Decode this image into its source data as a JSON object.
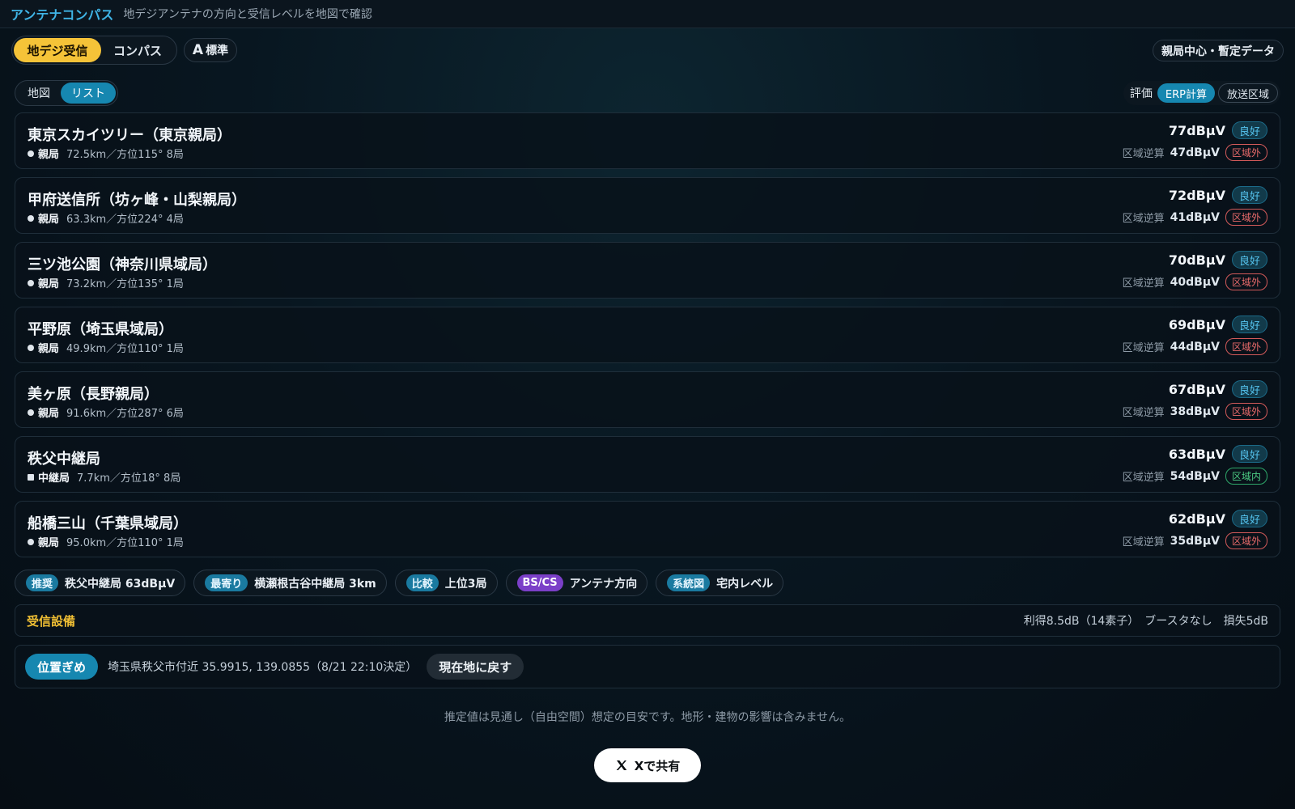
{
  "header": {
    "title": "アンテナコンパス",
    "subtitle": "地デジアンテナの方向と受信レベルを地図で確認"
  },
  "mode": {
    "tabs": [
      "地デジ受信",
      "コンパス"
    ],
    "size_glyph": "A",
    "size_label": "標準",
    "data_badge": "親局中心・暫定データ"
  },
  "view": {
    "options": [
      "地図",
      "リスト"
    ],
    "eval_label": "評価",
    "eval_options": [
      "ERP計算",
      "放送区域"
    ]
  },
  "stations": [
    {
      "name": "東京スカイツリー（東京親局）",
      "type": "親局",
      "meta": "72.5km／方位115°  8局",
      "level": "77dBμV",
      "grade": "良好",
      "rev_label": "区域逆算",
      "rev": "47dBμV",
      "zone": "区域外",
      "zone_in": false,
      "square": false
    },
    {
      "name": "甲府送信所（坊ヶ峰・山梨親局）",
      "type": "親局",
      "meta": "63.3km／方位224°  4局",
      "level": "72dBμV",
      "grade": "良好",
      "rev_label": "区域逆算",
      "rev": "41dBμV",
      "zone": "区域外",
      "zone_in": false,
      "square": false
    },
    {
      "name": "三ツ池公園（神奈川県域局）",
      "type": "親局",
      "meta": "73.2km／方位135°  1局",
      "level": "70dBμV",
      "grade": "良好",
      "rev_label": "区域逆算",
      "rev": "40dBμV",
      "zone": "区域外",
      "zone_in": false,
      "square": false
    },
    {
      "name": "平野原（埼玉県域局）",
      "type": "親局",
      "meta": "49.9km／方位110°  1局",
      "level": "69dBμV",
      "grade": "良好",
      "rev_label": "区域逆算",
      "rev": "44dBμV",
      "zone": "区域外",
      "zone_in": false,
      "square": false
    },
    {
      "name": "美ヶ原（長野親局）",
      "type": "親局",
      "meta": "91.6km／方位287°  6局",
      "level": "67dBμV",
      "grade": "良好",
      "rev_label": "区域逆算",
      "rev": "38dBμV",
      "zone": "区域外",
      "zone_in": false,
      "square": false
    },
    {
      "name": "秩父中継局",
      "type": "中継局",
      "meta": "7.7km／方位18°  8局",
      "level": "63dBμV",
      "grade": "良好",
      "rev_label": "区域逆算",
      "rev": "54dBμV",
      "zone": "区域内",
      "zone_in": true,
      "square": true
    },
    {
      "name": "船橋三山（千葉県域局）",
      "type": "親局",
      "meta": "95.0km／方位110°  1局",
      "level": "62dBμV",
      "grade": "良好",
      "rev_label": "区域逆算",
      "rev": "35dBμV",
      "zone": "区域外",
      "zone_in": false,
      "square": false
    }
  ],
  "chips": [
    {
      "tag": "推奨",
      "text": "秩父中継局 63dBμV",
      "tag_color": "blue"
    },
    {
      "tag": "最寄り",
      "text": "横瀬根古谷中継局 3km",
      "tag_color": "blue"
    },
    {
      "tag": "比較",
      "text": "上位3局",
      "tag_color": "blue"
    },
    {
      "tag": "BS/CS",
      "text": "アンテナ方向",
      "tag_color": "purple"
    },
    {
      "tag": "系統図",
      "text": "宅内レベル",
      "tag_color": "blue"
    }
  ],
  "equipment": {
    "title": "受信設備",
    "info": "利得8.5dB（14素子）　ブースタなし　損失5dB"
  },
  "location": {
    "badge": "位置ぎめ",
    "text": "埼玉県秩父市付近 35.9915, 139.0855（8/21 22:10決定）",
    "button": "現在地に戻す"
  },
  "disclaimer": "推定値は見通し（自由空間）想定の目安です。地形・建物の影響は含みません。",
  "share_label": "Xで共有",
  "colors": {
    "accent": "#1687b0",
    "highlight": "#f5c338",
    "title": "#3fb4e6",
    "out": "#e86a6a",
    "in": "#4ccb84"
  }
}
